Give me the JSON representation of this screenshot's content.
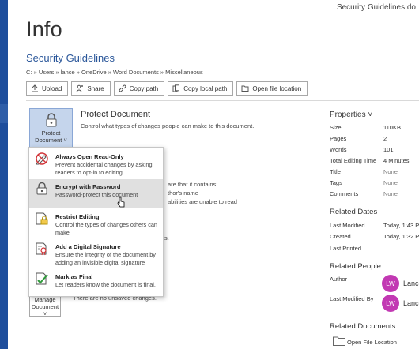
{
  "window": {
    "doc_name": "Security Guidelines.do"
  },
  "page": {
    "title": "Info",
    "doc_title": "Security Guidelines",
    "path": "C: » Users » lance » OneDrive » Word Documents » Miscellaneous"
  },
  "toolbar": {
    "buttons": [
      {
        "label": "Upload",
        "icon": "upload-icon"
      },
      {
        "label": "Share",
        "icon": "share-icon"
      },
      {
        "label": "Copy path",
        "icon": "copy-path-icon"
      },
      {
        "label": "Copy local path",
        "icon": "copy-local-path-icon"
      },
      {
        "label": "Open file location",
        "icon": "folder-icon"
      }
    ]
  },
  "protect": {
    "button_line1": "Protect",
    "button_line2": "Document ˅",
    "title": "Protect Document",
    "description": "Control what types of changes people can make to this document."
  },
  "menu": {
    "items": [
      {
        "title": "Always Open Read-Only",
        "desc": "Prevent accidental changes by asking readers to opt-in to editing.",
        "icon": "read-only-icon"
      },
      {
        "title": "Encrypt with Password",
        "desc": "Password-protect this document",
        "icon": "encrypt-lock-icon",
        "selected": true
      },
      {
        "title": "Restrict Editing",
        "desc": "Control the types of changes others can make",
        "icon": "restrict-editing-icon"
      },
      {
        "title": "Add a Digital Signature",
        "desc": "Ensure the integrity of the document by adding an invisible digital signature",
        "icon": "digital-signature-icon"
      },
      {
        "title": "Mark as Final",
        "desc": "Let readers know the document is final.",
        "icon": "mark-final-icon"
      }
    ]
  },
  "background_text": {
    "inspect_fragment": "are that it contains:",
    "author_fragment": "thor's name",
    "disability_fragment": "abilities are unable to read",
    "versions_fragment": "s.",
    "unsaved_fragment": "There are no unsaved changes."
  },
  "manage": {
    "line1": "Manage",
    "line2": "Document ˅"
  },
  "properties": {
    "title": "Properties ˅",
    "rows": [
      {
        "label": "Size",
        "value": "110KB"
      },
      {
        "label": "Pages",
        "value": "2"
      },
      {
        "label": "Words",
        "value": "101"
      },
      {
        "label": "Total Editing Time",
        "value": "4 Minutes"
      },
      {
        "label": "Title",
        "value": "None"
      },
      {
        "label": "Tags",
        "value": "None"
      },
      {
        "label": "Comments",
        "value": "None"
      }
    ]
  },
  "related_dates": {
    "title": "Related Dates",
    "rows": [
      {
        "label": "Last Modified",
        "value": "Today, 1:43 P"
      },
      {
        "label": "Created",
        "value": "Today, 1:32 P"
      },
      {
        "label": "Last Printed",
        "value": ""
      }
    ]
  },
  "related_people": {
    "title": "Related People",
    "author_label": "Author",
    "author_initials": "LW",
    "author_name": "Lance",
    "modified_label": "Last Modified By",
    "modified_initials": "LW",
    "modified_name": "Lance"
  },
  "related_documents": {
    "title": "Related Documents",
    "open_file_location": "Open File Location"
  },
  "colors": {
    "accent": "#2b579a",
    "avatar": "#c239b3",
    "menu_selected": "#e0e0e0"
  }
}
